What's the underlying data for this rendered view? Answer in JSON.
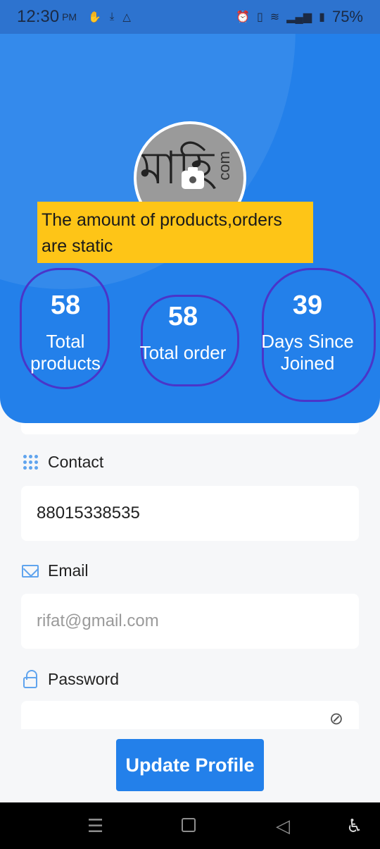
{
  "status_bar": {
    "time": "12:30",
    "ampm": "PM",
    "left_icons": [
      "gesture-icon",
      "download-icon",
      "drive-icon"
    ],
    "right_icons": [
      "alarm-icon",
      "vibrate-icon",
      "data-icon",
      "wifi-icon",
      "signal-icon",
      "battery-icon"
    ],
    "battery": "75%"
  },
  "profile": {
    "avatar_text": "মাহি",
    "avatar_side_text": "com"
  },
  "note": "The amount of products,orders are static",
  "stats": [
    {
      "value": "58",
      "label": "Total products"
    },
    {
      "value": "58",
      "label": "Total order"
    },
    {
      "value": "39",
      "label": "Days Since Joined"
    }
  ],
  "form": {
    "contact": {
      "label": "Contact",
      "value": "88015338535"
    },
    "email": {
      "label": "Email",
      "placeholder": "rifat@gmail.com"
    },
    "password": {
      "label": "Password",
      "visibility_icon": "eye-off-icon"
    }
  },
  "update_button": "Update Profile",
  "nav": {
    "menu_glyph": "☰",
    "back_glyph": "◁",
    "accessibility_glyph": "♿"
  }
}
